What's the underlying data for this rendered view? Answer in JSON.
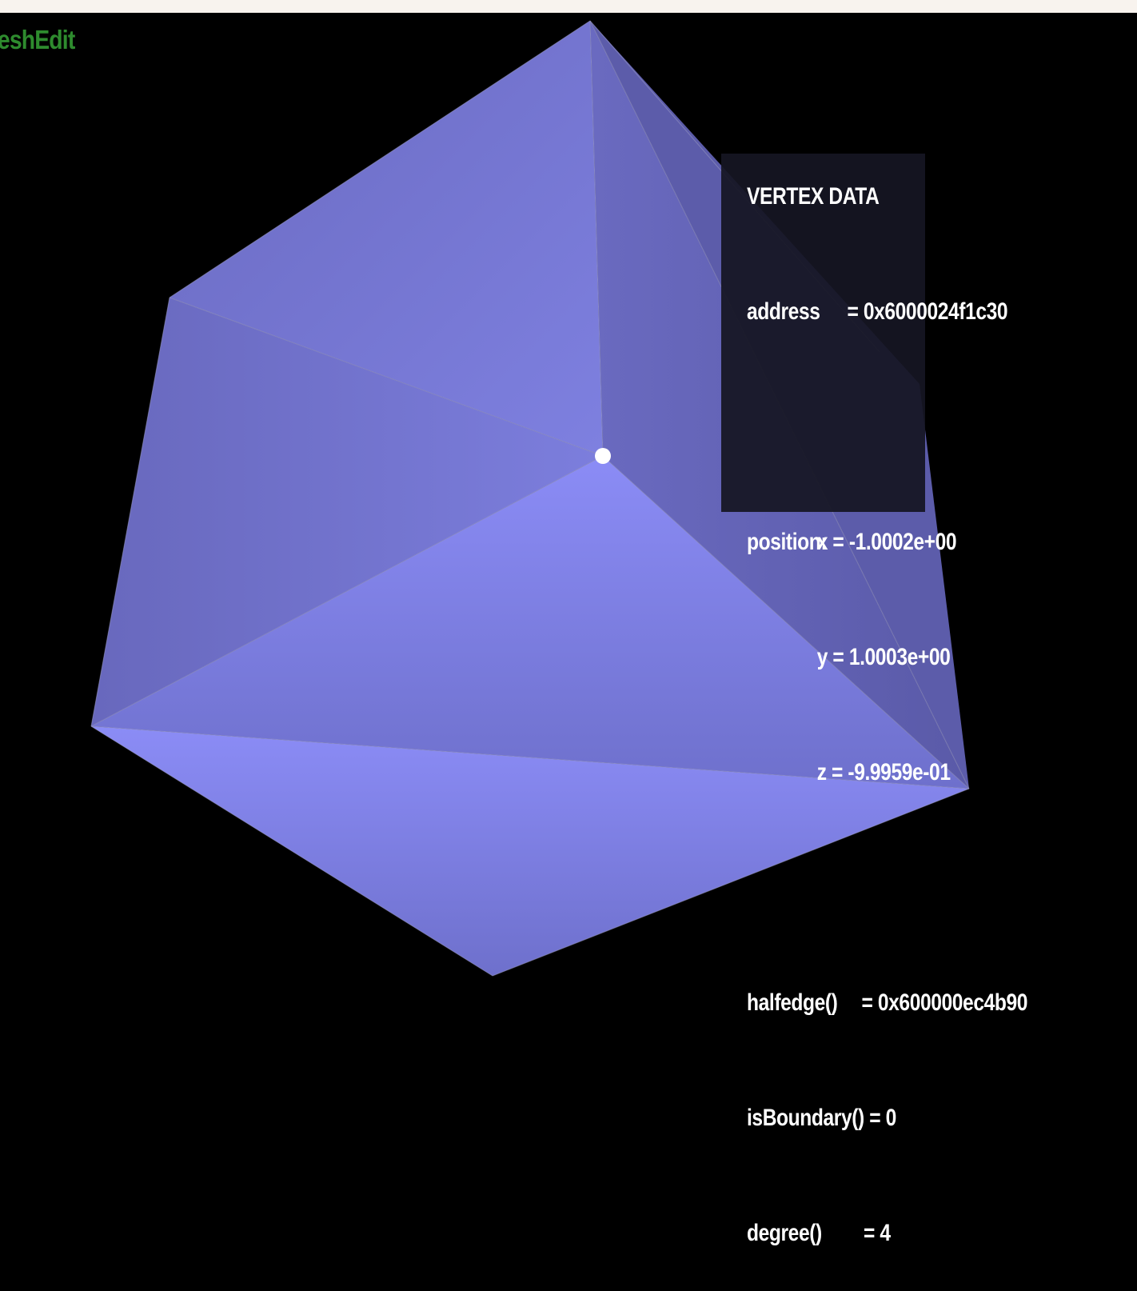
{
  "app": {
    "title_visible": "eshEdit",
    "title_color": "#2e8b2e"
  },
  "colors": {
    "background": "#000000",
    "top_strip": "#f8f3ee",
    "mesh_fill_base": "#7b7ee0",
    "mesh_edge": "#9a9ac0",
    "selected_vertex": "#ffffff",
    "panel_background": "#161622",
    "panel_text": "#ffffff"
  },
  "vertex_panel": {
    "heading": "VERTEX DATA",
    "address_label": "address",
    "address_value": "= 0x6000024f1c30",
    "position_label": "position:",
    "x_value": "x = -1.0002e+00",
    "y_value": "y = 1.0003e+00",
    "z_value": "z = -9.9959e-01",
    "halfedge_label": "halfedge()",
    "halfedge_value": "= 0x600000ec4b90",
    "isboundary_label": "isBoundary()",
    "isboundary_value": "= 0",
    "degree_label": "degree()",
    "degree_value": "= 4"
  }
}
